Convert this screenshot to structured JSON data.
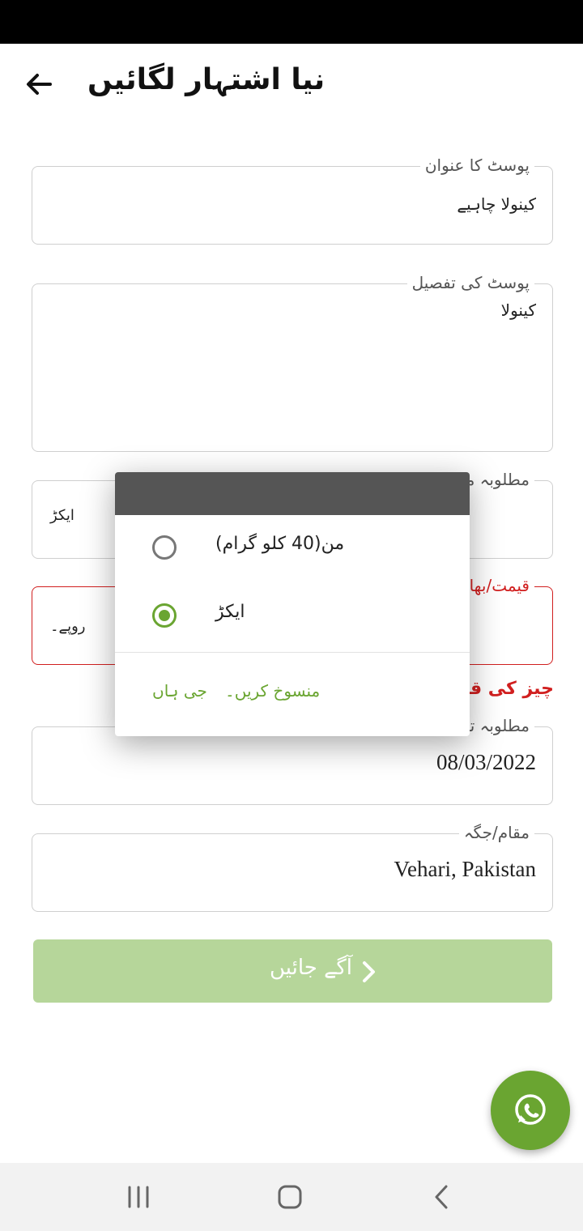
{
  "header": {
    "title": "نیا اشتہار لگائیں",
    "back_icon": "arrow-left-icon"
  },
  "form": {
    "post_title": {
      "label": "پوسٹ کا عنوان",
      "value": "کینولا چاہیے"
    },
    "post_detail": {
      "label": "پوسٹ کی تفصیل",
      "value": "کینولا"
    },
    "quantity": {
      "label": "مطلوبہ مقدار",
      "unit": "ایکڑ"
    },
    "price": {
      "label": "قیمت/بھاؤ",
      "currency": "روپے۔"
    },
    "price_error": "چیز کی قیمت درج کریں",
    "date": {
      "label": "مطلوبہ تاریخ",
      "value": "08/03/2022"
    },
    "location": {
      "label": "مقام/جگہ",
      "value": "Vehari, Pakistan"
    }
  },
  "next_button": {
    "label": "آگے جائیں",
    "icon": "chevron-right-icon"
  },
  "fab": {
    "icon": "whatsapp-icon",
    "color": "#6aa531"
  },
  "dialog": {
    "options": [
      {
        "label": "من(40 کلو گرام)",
        "selected": false
      },
      {
        "label": "ایکڑ",
        "selected": true
      }
    ],
    "cancel_label": "منسوخ کریں۔",
    "ok_label": "جی ہاں"
  },
  "colors": {
    "accent": "#6aa531",
    "error": "#d11f1f",
    "button_disabled": "#b6d69a",
    "dialog_header": "#555555"
  },
  "nav": {
    "icons": [
      "recent-apps-icon",
      "home-icon",
      "back-icon"
    ]
  }
}
